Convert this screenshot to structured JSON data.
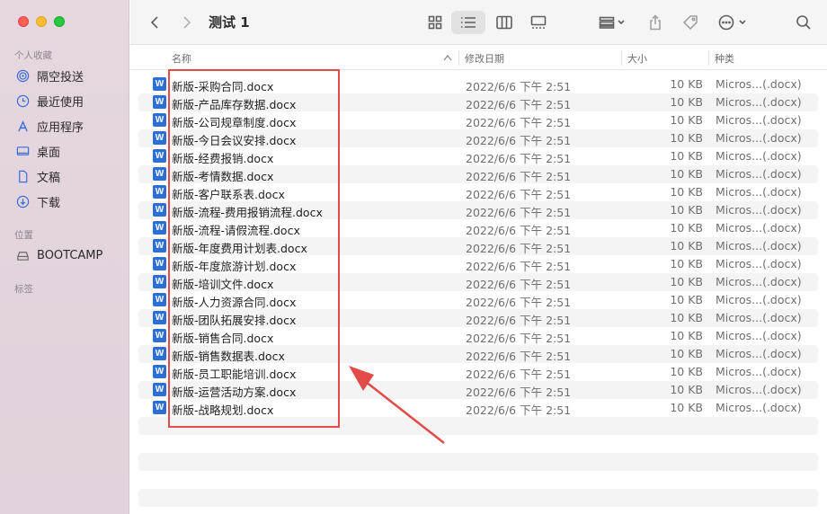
{
  "window": {
    "title": "测试 1"
  },
  "sidebar": {
    "favorites_label": "个人收藏",
    "favorites": [
      {
        "label": "隔空投送",
        "icon": "airdrop-icon"
      },
      {
        "label": "最近使用",
        "icon": "clock-icon"
      },
      {
        "label": "应用程序",
        "icon": "apps-icon"
      },
      {
        "label": "桌面",
        "icon": "desktop-icon"
      },
      {
        "label": "文稿",
        "icon": "document-icon"
      },
      {
        "label": "下载",
        "icon": "download-icon"
      }
    ],
    "locations_label": "位置",
    "locations": [
      {
        "label": "BOOTCAMP",
        "icon": "disk-icon"
      }
    ],
    "tags_label": "标签"
  },
  "columns": {
    "name": "名称",
    "modified": "修改日期",
    "size": "大小",
    "kind": "种类"
  },
  "files": [
    {
      "name": "新版-采购合同.docx",
      "date": "2022/6/6 下午 2:51",
      "size": "10 KB",
      "kind": "Micros...(.docx)"
    },
    {
      "name": "新版-产品库存数据.docx",
      "date": "2022/6/6 下午 2:51",
      "size": "10 KB",
      "kind": "Micros...(.docx)"
    },
    {
      "name": "新版-公司规章制度.docx",
      "date": "2022/6/6 下午 2:51",
      "size": "10 KB",
      "kind": "Micros...(.docx)"
    },
    {
      "name": "新版-今日会议安排.docx",
      "date": "2022/6/6 下午 2:51",
      "size": "10 KB",
      "kind": "Micros...(.docx)"
    },
    {
      "name": "新版-经费报销.docx",
      "date": "2022/6/6 下午 2:51",
      "size": "10 KB",
      "kind": "Micros...(.docx)"
    },
    {
      "name": "新版-考情数据.docx",
      "date": "2022/6/6 下午 2:51",
      "size": "10 KB",
      "kind": "Micros...(.docx)"
    },
    {
      "name": "新版-客户联系表.docx",
      "date": "2022/6/6 下午 2:51",
      "size": "10 KB",
      "kind": "Micros...(.docx)"
    },
    {
      "name": "新版-流程-费用报销流程.docx",
      "date": "2022/6/6 下午 2:51",
      "size": "10 KB",
      "kind": "Micros...(.docx)"
    },
    {
      "name": "新版-流程-请假流程.docx",
      "date": "2022/6/6 下午 2:51",
      "size": "10 KB",
      "kind": "Micros...(.docx)"
    },
    {
      "name": "新版-年度费用计划表.docx",
      "date": "2022/6/6 下午 2:51",
      "size": "10 KB",
      "kind": "Micros...(.docx)"
    },
    {
      "name": "新版-年度旅游计划.docx",
      "date": "2022/6/6 下午 2:51",
      "size": "10 KB",
      "kind": "Micros...(.docx)"
    },
    {
      "name": "新版-培训文件.docx",
      "date": "2022/6/6 下午 2:51",
      "size": "10 KB",
      "kind": "Micros...(.docx)"
    },
    {
      "name": "新版-人力资源合同.docx",
      "date": "2022/6/6 下午 2:51",
      "size": "10 KB",
      "kind": "Micros...(.docx)"
    },
    {
      "name": "新版-团队拓展安排.docx",
      "date": "2022/6/6 下午 2:51",
      "size": "10 KB",
      "kind": "Micros...(.docx)"
    },
    {
      "name": "新版-销售合同.docx",
      "date": "2022/6/6 下午 2:51",
      "size": "10 KB",
      "kind": "Micros...(.docx)"
    },
    {
      "name": "新版-销售数据表.docx",
      "date": "2022/6/6 下午 2:51",
      "size": "10 KB",
      "kind": "Micros...(.docx)"
    },
    {
      "name": "新版-员工职能培训.docx",
      "date": "2022/6/6 下午 2:51",
      "size": "10 KB",
      "kind": "Micros...(.docx)"
    },
    {
      "name": "新版-运营活动方案.docx",
      "date": "2022/6/6 下午 2:51",
      "size": "10 KB",
      "kind": "Micros...(.docx)"
    },
    {
      "name": "新版-战略规划.docx",
      "date": "2022/6/6 下午 2:51",
      "size": "10 KB",
      "kind": "Micros...(.docx)"
    }
  ],
  "file_icon_letter": "W",
  "colors": {
    "accent": "#2b6fd6",
    "annotation": "#e34a4a"
  }
}
